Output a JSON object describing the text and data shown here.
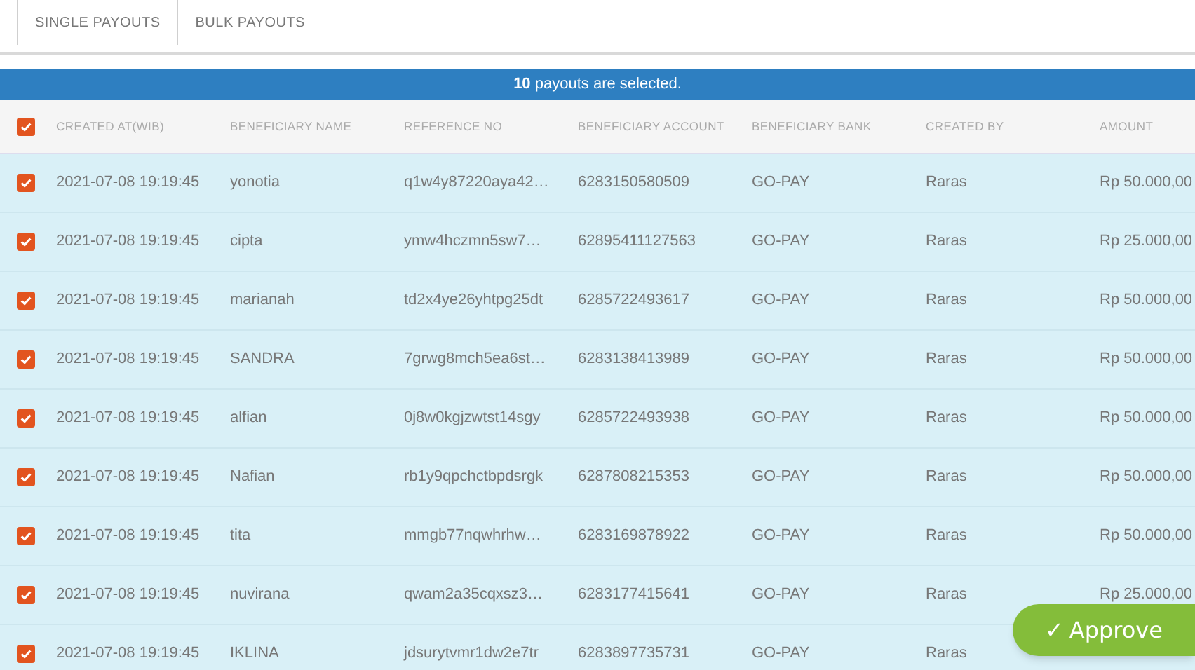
{
  "tabs": [
    {
      "label": "SINGLE PAYOUTS"
    },
    {
      "label": "BULK PAYOUTS"
    }
  ],
  "banner": {
    "count": "10",
    "text": "payouts are selected."
  },
  "table": {
    "all_checked": true,
    "columns": [
      "CREATED AT(WIB)",
      "BENEFICIARY NAME",
      "REFERENCE NO",
      "BENEFICIARY ACCOUNT",
      "BENEFICIARY BANK",
      "CREATED BY",
      "AMOUNT"
    ],
    "rows": [
      {
        "checked": true,
        "cells": [
          "2021-07-08 19:19:45",
          "yonotia",
          "q1w4y87220aya42…",
          "6283150580509",
          "GO-PAY",
          "Raras",
          "Rp 50.000,00"
        ]
      },
      {
        "checked": true,
        "cells": [
          "2021-07-08 19:19:45",
          "cipta",
          "ymw4hczmn5sw7…",
          "62895411127563",
          "GO-PAY",
          "Raras",
          "Rp 25.000,00"
        ]
      },
      {
        "checked": true,
        "cells": [
          "2021-07-08 19:19:45",
          "marianah",
          "td2x4ye26yhtpg25dt",
          "6285722493617",
          "GO-PAY",
          "Raras",
          "Rp 50.000,00"
        ]
      },
      {
        "checked": true,
        "cells": [
          "2021-07-08 19:19:45",
          "SANDRA",
          "7grwg8mch5ea6st…",
          "6283138413989",
          "GO-PAY",
          "Raras",
          "Rp 50.000,00"
        ]
      },
      {
        "checked": true,
        "cells": [
          "2021-07-08 19:19:45",
          "alfian",
          "0j8w0kgjzwtst14sgy",
          "6285722493938",
          "GO-PAY",
          "Raras",
          "Rp 50.000,00"
        ]
      },
      {
        "checked": true,
        "cells": [
          "2021-07-08 19:19:45",
          "Nafian",
          "rb1y9qpchctbpdsrgk",
          "6287808215353",
          "GO-PAY",
          "Raras",
          "Rp 50.000,00"
        ]
      },
      {
        "checked": true,
        "cells": [
          "2021-07-08 19:19:45",
          "tita",
          "mmgb77nqwhrhw…",
          "6283169878922",
          "GO-PAY",
          "Raras",
          "Rp 50.000,00"
        ]
      },
      {
        "checked": true,
        "cells": [
          "2021-07-08 19:19:45",
          "nuvirana",
          "qwam2a35cqxsz3…",
          "6283177415641",
          "GO-PAY",
          "Raras",
          "Rp 25.000,00"
        ]
      },
      {
        "checked": true,
        "cells": [
          "2021-07-08 19:19:45",
          "IKLINA",
          "jdsurytvmr1dw2e7tr",
          "6283897735731",
          "GO-PAY",
          "Raras"
        ]
      }
    ]
  },
  "approve_button": {
    "icon": "✓",
    "label": "Approve"
  }
}
